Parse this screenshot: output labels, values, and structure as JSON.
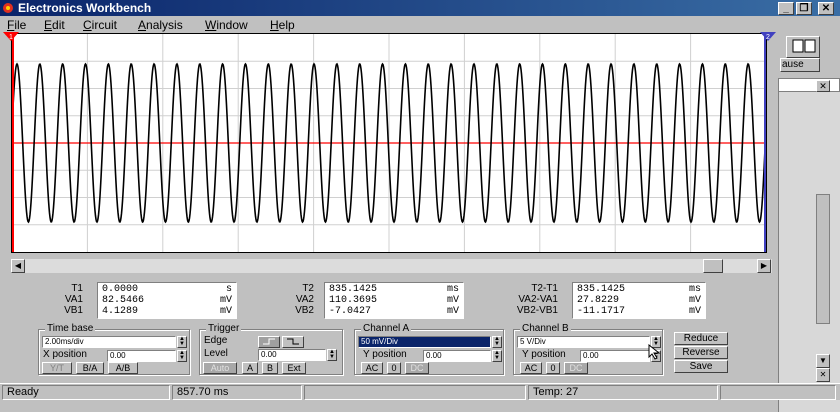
{
  "window": {
    "title": "Electronics Workbench",
    "min": "_",
    "max": "❐",
    "close": "✕"
  },
  "menu": [
    "File",
    "Edit",
    "Circuit",
    "Analysis",
    "Window",
    "Help"
  ],
  "menu_underline": [
    "F",
    "E",
    "C",
    "A",
    "W",
    "H"
  ],
  "menu_rest": [
    "ile",
    "dit",
    "ircuit",
    "nalysis",
    "indow",
    "elp"
  ],
  "right_panel": {
    "pause_label": "ause"
  },
  "cursor_markers": {
    "t1": "1",
    "t2": "2"
  },
  "readouts": {
    "cursor1": {
      "labels": [
        "T1",
        "VA1",
        "VB1"
      ],
      "values": [
        [
          "0.0000",
          "s"
        ],
        [
          "82.5466",
          "mV"
        ],
        [
          "4.1289",
          "mV"
        ]
      ]
    },
    "cursor2": {
      "labels": [
        "T2",
        "VA2",
        "VB2"
      ],
      "values": [
        [
          "835.1425",
          "ms"
        ],
        [
          "110.3695",
          "mV"
        ],
        [
          "-7.0427",
          "mV"
        ]
      ]
    },
    "diff": {
      "labels": [
        "T2-T1",
        "VA2-VA1",
        "VB2-VB1"
      ],
      "values": [
        [
          "835.1425",
          "ms"
        ],
        [
          "27.8229",
          "mV"
        ],
        [
          "-11.1717",
          "mV"
        ]
      ]
    }
  },
  "timebase": {
    "title": "Time base",
    "scale": "2.00ms/div",
    "xpos_label": "X position",
    "xpos": "0.00",
    "buttons": [
      "Y/T",
      "B/A",
      "A/B"
    ]
  },
  "trigger": {
    "title": "Trigger",
    "edge_label": "Edge",
    "level_label": "Level",
    "level": "0.00",
    "buttons": [
      "Auto",
      "A",
      "B",
      "Ext"
    ]
  },
  "channelA": {
    "title": "Channel A",
    "scale": "50 mV/Div",
    "ypos_label": "Y position",
    "ypos": "0.00",
    "buttons": [
      "AC",
      "0",
      "DC"
    ]
  },
  "channelB": {
    "title": "Channel B",
    "scale": "5 V/Div",
    "ypos_label": "Y position",
    "ypos": "0.00",
    "buttons": [
      "AC",
      "0",
      "DC"
    ]
  },
  "actions": [
    "Reduce",
    "Reverse",
    "Save"
  ],
  "status": {
    "state": "Ready",
    "time": "857.70 ms",
    "temp": "Temp:  27"
  },
  "colors": {
    "trace_a": "#000000",
    "trace_b": "#ff0000",
    "cursor1": "#ff0000",
    "cursor2": "#4040c0",
    "titlebar": "#0a246a"
  },
  "waveform": {
    "cycles": 33,
    "amplitude_divs": 2.9
  }
}
